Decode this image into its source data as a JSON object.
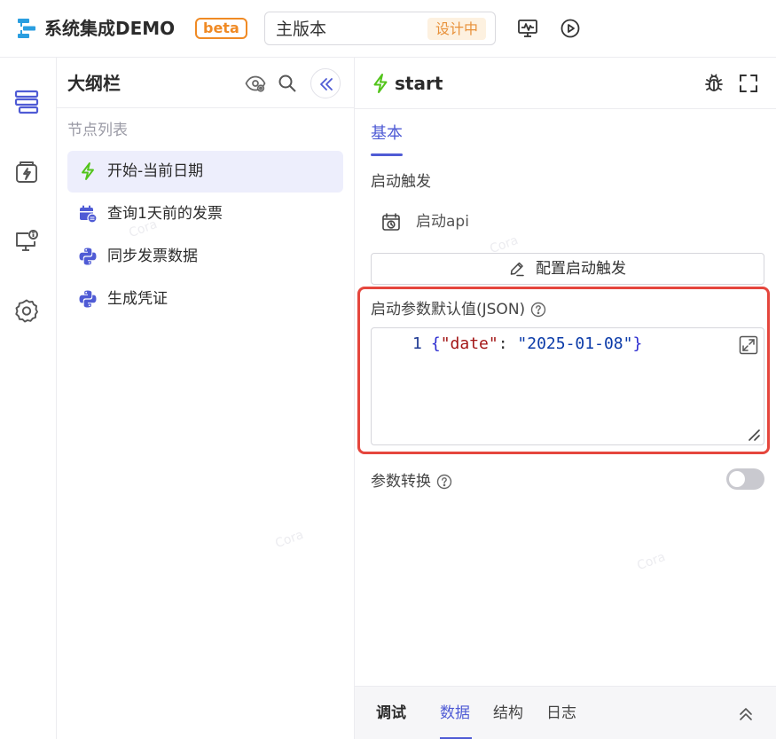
{
  "header": {
    "app_title": "系统集成DEMO",
    "beta_badge": "beta",
    "version_name": "主版本",
    "version_status": "设计中"
  },
  "rail": {
    "items": [
      "flow-layers-icon",
      "app-flash-icon",
      "monitor-info-icon",
      "gear-icon"
    ]
  },
  "outline": {
    "title": "大纲栏",
    "node_list_label": "节点列表",
    "nodes": [
      {
        "label": "开始-当前日期",
        "icon": "bolt-icon",
        "active": true
      },
      {
        "label": "查询1天前的发票",
        "icon": "calendar-query-icon",
        "active": false
      },
      {
        "label": "同步发票数据",
        "icon": "python-icon",
        "active": false
      },
      {
        "label": "生成凭证",
        "icon": "python-icon",
        "active": false
      }
    ]
  },
  "detail": {
    "title": "start",
    "tab_basic": "基本",
    "trigger_section": "启动触发",
    "trigger_item": "启动api",
    "config_button": "配置启动触发",
    "param_label": "启动参数默认值(JSON)",
    "json_code": {
      "line_no": "1",
      "open": "{",
      "key": "\"date\"",
      "colon": ": ",
      "value": "\"2025-01-08\"",
      "close": "}"
    },
    "conversion_label": "参数转换",
    "conversion_enabled": false
  },
  "bottom": {
    "title": "调试",
    "tabs": [
      "数据",
      "结构",
      "日志"
    ],
    "active_tab": "数据"
  },
  "watermark": "Cora",
  "colors": {
    "accent": "#4f5bd5",
    "beta": "#f08a24",
    "status_bg": "#fdf1e0",
    "status_text": "#e8913a",
    "highlight": "#e5463d",
    "bolt": "#52c41a",
    "python": "#4f5bd5"
  }
}
